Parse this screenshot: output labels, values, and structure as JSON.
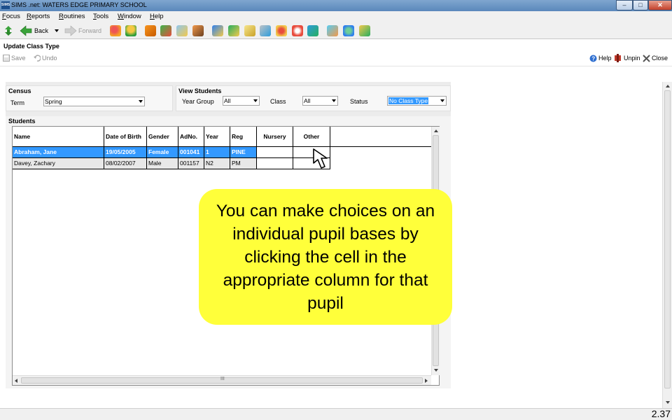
{
  "window": {
    "title": "SIMS .net: WATERS EDGE PRIMARY SCHOOL",
    "logo_text": "SIMS",
    "controls": {
      "minimize": "–",
      "maximize": "□",
      "close": "✕"
    }
  },
  "menu": [
    "Focus",
    "Reports",
    "Routines",
    "Tools",
    "Window",
    "Help"
  ],
  "toolbar": {
    "back_label": "Back",
    "forward_label": "Forward"
  },
  "page": {
    "title": "Update Class Type",
    "save_label": "Save",
    "undo_label": "Undo",
    "help_label": "Help",
    "unpin_label": "Unpin",
    "close_label": "Close"
  },
  "census": {
    "heading": "Census",
    "term_label": "Term",
    "term_value": "Spring"
  },
  "view_students": {
    "heading": "View Students",
    "year_group_label": "Year Group",
    "year_group_value": "All",
    "class_label": "Class",
    "class_value": "All",
    "status_label": "Status",
    "status_value": "No Class Type"
  },
  "students": {
    "heading": "Students",
    "columns": [
      "Name",
      "Date of Birth",
      "Gender",
      "AdNo.",
      "Year",
      "Reg",
      "Nursery",
      "Other"
    ],
    "rows": [
      [
        "Abraham, Jane",
        "19/05/2005",
        "Female",
        "001041",
        "1",
        "PINE",
        "",
        ""
      ],
      [
        "Davey, Zachary",
        "08/02/2007",
        "Male",
        "001157",
        "N2",
        "PM",
        "",
        ""
      ]
    ],
    "hscroll_grip": "III"
  },
  "callout": {
    "text": "You can make choices on an individual pupil bases by clicking the cell in the appropriate column for that pupil"
  },
  "slide_number": "2.37",
  "colors": {
    "selection": "#3399ff",
    "callout": "#ffff3a",
    "titlebar": "#6b95c5"
  }
}
